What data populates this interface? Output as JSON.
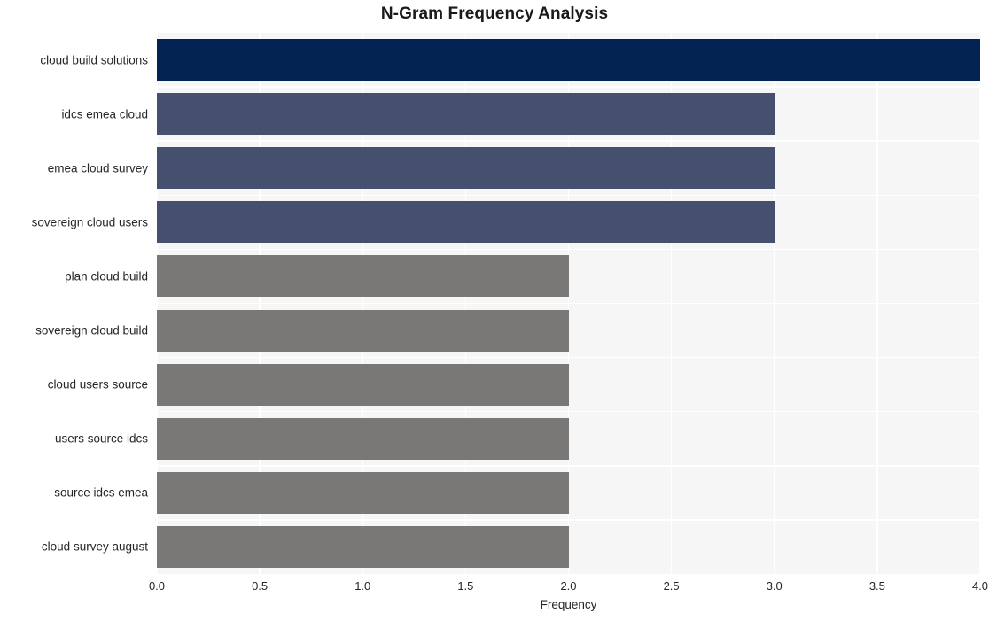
{
  "chart_data": {
    "type": "bar",
    "orientation": "horizontal",
    "title": "N-Gram Frequency Analysis",
    "xlabel": "Frequency",
    "ylabel": "",
    "categories": [
      "cloud build solutions",
      "idcs emea cloud",
      "emea cloud survey",
      "sovereign cloud users",
      "plan cloud build",
      "sovereign cloud build",
      "cloud users source",
      "users source idcs",
      "source idcs emea",
      "cloud survey august"
    ],
    "values": [
      4,
      3,
      3,
      3,
      2,
      2,
      2,
      2,
      2,
      2
    ],
    "bar_colors": [
      "#032452",
      "#454f6e",
      "#454f6e",
      "#454f6e",
      "#7a7877",
      "#7a7877",
      "#7a7877",
      "#7a7877",
      "#7a7877",
      "#7a7877"
    ],
    "xlim": [
      0.0,
      4.0
    ],
    "xticks": [
      0.0,
      0.5,
      1.0,
      1.5,
      2.0,
      2.5,
      3.0,
      3.5,
      4.0
    ],
    "xtick_labels": [
      "0.0",
      "0.5",
      "1.0",
      "1.5",
      "2.0",
      "2.5",
      "3.0",
      "3.5",
      "4.0"
    ],
    "grid": true,
    "grid_color": "#ffffff",
    "plot_background": "#f6f6f7",
    "figure_background": "#ffffff",
    "legend": null,
    "title_color": "#1a1a1a",
    "tick_label_color": "#262626"
  }
}
